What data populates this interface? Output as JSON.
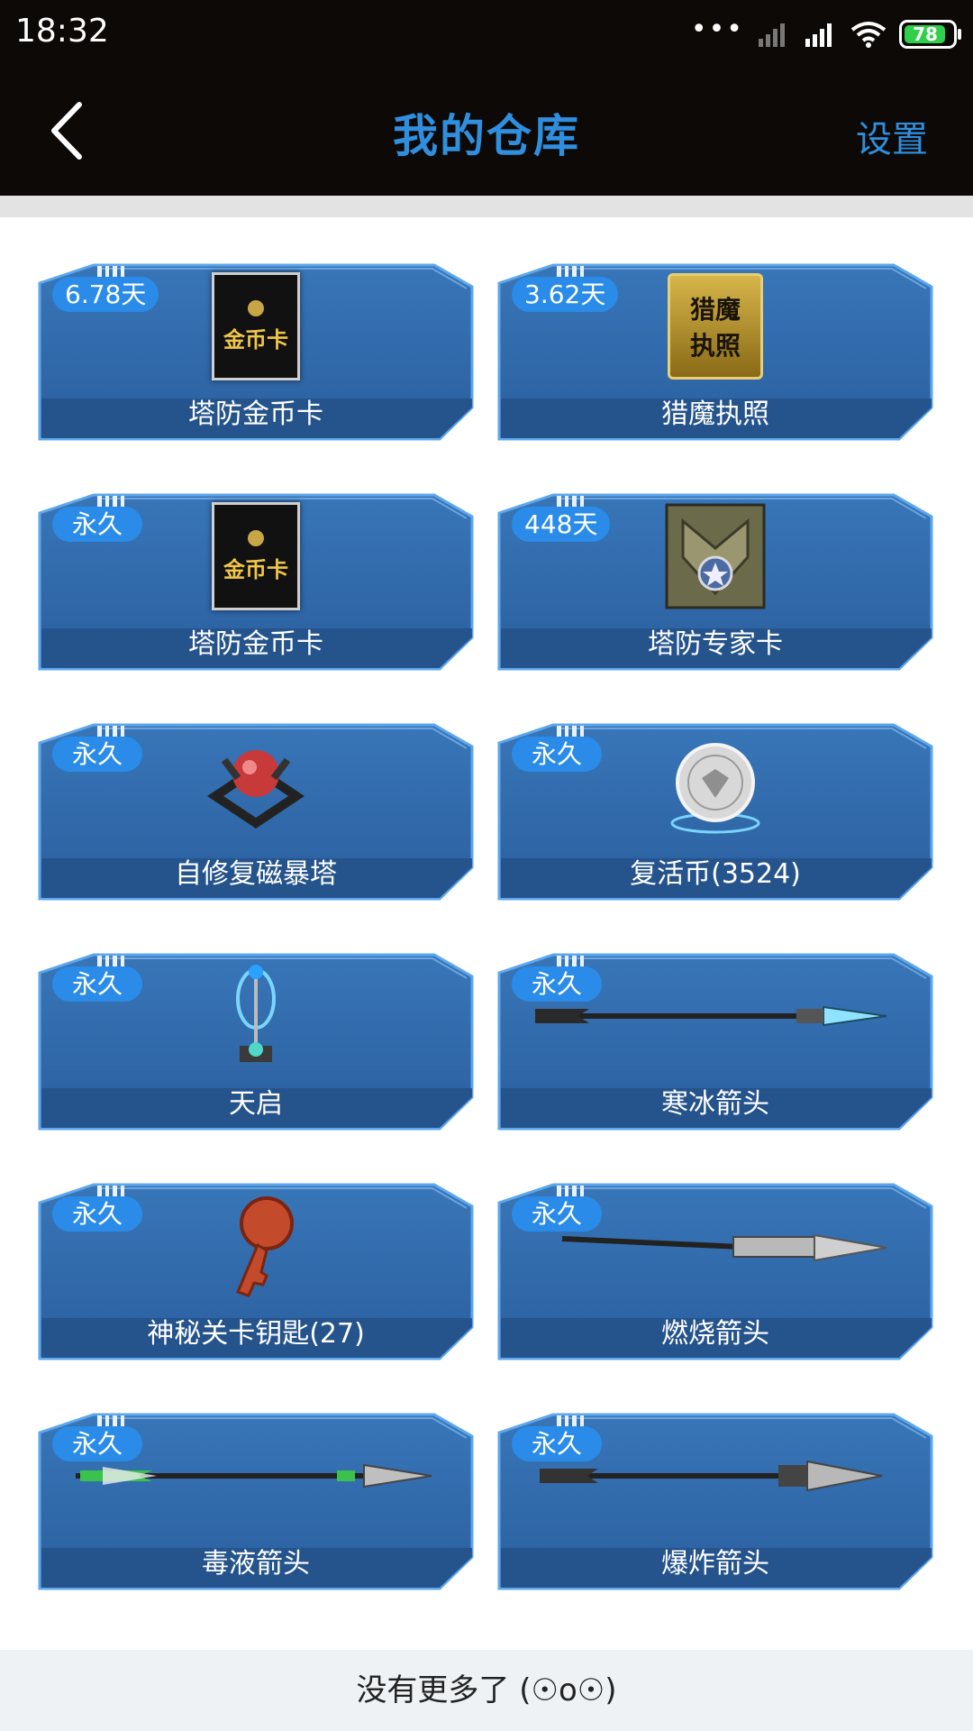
{
  "status_bar": {
    "time": "18:32",
    "battery": "78"
  },
  "header": {
    "title": "我的仓库",
    "settings_label": "设置"
  },
  "items": [
    {
      "badge": "6.78天",
      "name": "塔防金币卡",
      "icon": "gold-coin-card"
    },
    {
      "badge": "3.62天",
      "name": "猎魔执照",
      "icon": "demon-hunter-license"
    },
    {
      "badge": "永久",
      "name": "塔防金币卡",
      "icon": "gold-coin-card"
    },
    {
      "badge": "448天",
      "name": "塔防专家卡",
      "icon": "tower-defense-expert-card"
    },
    {
      "badge": "永久",
      "name": "自修复磁暴塔",
      "icon": "self-repair-tesla-tower"
    },
    {
      "badge": "永久",
      "name": "复活币(3524)",
      "icon": "revive-coin"
    },
    {
      "badge": "永久",
      "name": "天启",
      "icon": "apocalypse-tower"
    },
    {
      "badge": "永久",
      "name": "寒冰箭头",
      "icon": "ice-arrow"
    },
    {
      "badge": "永久",
      "name": "神秘关卡钥匙(27)",
      "icon": "mystery-level-key"
    },
    {
      "badge": "永久",
      "name": "燃烧箭头",
      "icon": "burning-arrow"
    },
    {
      "badge": "永久",
      "name": "毒液箭头",
      "icon": "venom-arrow"
    },
    {
      "badge": "永久",
      "name": "爆炸箭头",
      "icon": "explosive-arrow"
    }
  ],
  "icon_labels": {
    "gold_card_text": "金币卡",
    "license_text_1": "猎魔",
    "license_text_2": "执照"
  },
  "footer": {
    "text": "没有更多了 (☉o☉)"
  },
  "colors": {
    "accent": "#2f8ede",
    "badge": "#2a8ce8",
    "card_bg": "#2f66a8"
  }
}
